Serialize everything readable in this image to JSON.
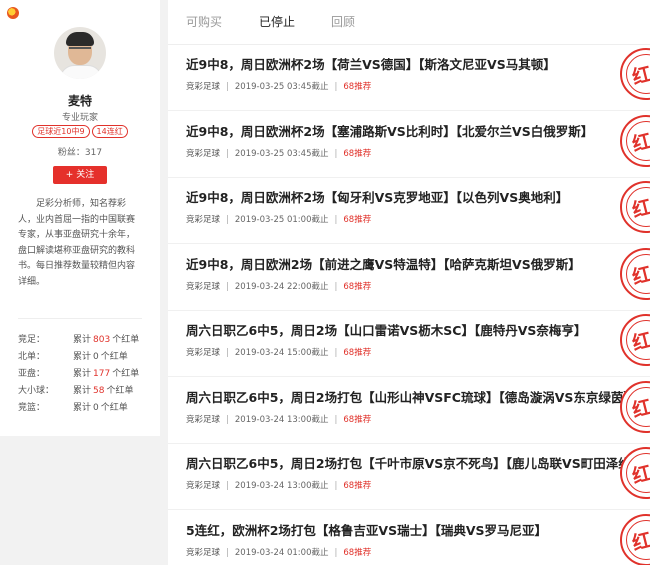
{
  "profile": {
    "name": "麦特",
    "role": "专业玩家",
    "badges": [
      "足球近10中9",
      "14连红"
    ],
    "fans": "粉丝：317",
    "follow_label": "+ 关注",
    "bio": "足彩分析师，知名荐彩人，业内首屈一指的中国联赛专家，从事亚盘研究十余年，盘口解读堪称亚盘研究的教科书。每日推荐数量较精但内容详细。",
    "stats": [
      {
        "label": "竞足：",
        "pre": "累计",
        "count": "803",
        "post": "个红单"
      },
      {
        "label": "北单：",
        "pre": "累计",
        "count": "0",
        "post": "个红单"
      },
      {
        "label": "亚盘：",
        "pre": "累计",
        "count": "177",
        "post": "个红单"
      },
      {
        "label": "大小球：",
        "pre": "累计",
        "count": "58",
        "post": "个红单"
      },
      {
        "label": "竞篮：",
        "pre": "累计",
        "count": "0",
        "post": "个红单"
      }
    ]
  },
  "tabs": [
    {
      "label": "可购买"
    },
    {
      "label": "已停止"
    },
    {
      "label": "回顾"
    }
  ],
  "items": [
    {
      "title": "近9中8，周日欧洲杯2场【荷兰VS德国】【斯洛文尼亚VS马其顿】",
      "category": "竞彩足球",
      "time": "2019-03-25 03:45截止",
      "status": "68推荐",
      "stamp": "红"
    },
    {
      "title": "近9中8，周日欧洲杯2场【塞浦路斯VS比利时】【北爱尔兰VS白俄罗斯】",
      "category": "竞彩足球",
      "time": "2019-03-25 03:45截止",
      "status": "68推荐",
      "stamp": "红"
    },
    {
      "title": "近9中8，周日欧洲杯2场【匈牙利VS克罗地亚】【以色列VS奥地利】",
      "category": "竞彩足球",
      "time": "2019-03-25 01:00截止",
      "status": "68推荐",
      "stamp": "红"
    },
    {
      "title": "近9中8，周日欧洲2场【前进之鹰VS特温特】【哈萨克斯坦VS俄罗斯】",
      "category": "竞彩足球",
      "time": "2019-03-24 22:00截止",
      "status": "68推荐",
      "stamp": "红"
    },
    {
      "title": "周六日职乙6中5，周日2场【山口雷诺VS枥木SC】【鹿特丹VS奈梅亨】",
      "category": "竞彩足球",
      "time": "2019-03-24 15:00截止",
      "status": "68推荐",
      "stamp": "红"
    },
    {
      "title": "周六日职乙6中5，周日2场打包【山形山神VSFC琉球】【德岛漩涡VS东京绿茵】",
      "category": "竞彩足球",
      "time": "2019-03-24 13:00截止",
      "status": "68推荐",
      "stamp": "红"
    },
    {
      "title": "周六日职乙6中5，周日2场打包【千叶市原VS京不死鸟】【鹿儿岛联VS町田泽维】",
      "category": "竞彩足球",
      "time": "2019-03-24 13:00截止",
      "status": "68推荐",
      "stamp": "红"
    },
    {
      "title": "5连红，欧洲杯2场打包【格鲁吉亚VS瑞士】【瑞典VS罗马尼亚】",
      "category": "竞彩足球",
      "time": "2019-03-24 01:00截止",
      "status": "68推荐",
      "stamp": "红"
    }
  ]
}
